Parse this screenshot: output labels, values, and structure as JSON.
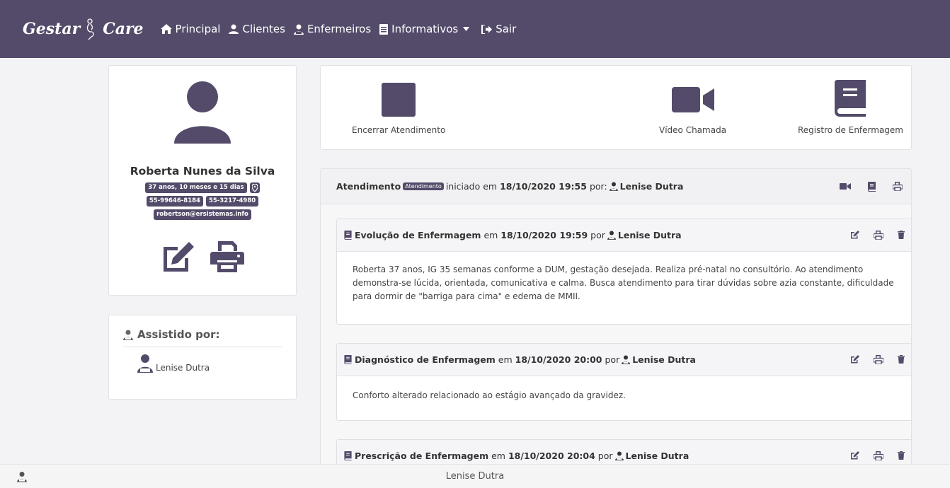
{
  "brand": {
    "name_left": "Gestar",
    "name_right": "Care"
  },
  "nav": {
    "items": [
      {
        "label": "Principal",
        "icon": "home-icon"
      },
      {
        "label": "Clientes",
        "icon": "user-icon"
      },
      {
        "label": "Enfermeiros",
        "icon": "user-nurse-icon"
      },
      {
        "label": "Informativos",
        "icon": "document-icon",
        "dropdown": true
      },
      {
        "label": "Sair",
        "icon": "sign-out-icon"
      }
    ]
  },
  "patient": {
    "name": "Roberta Nunes da Silva",
    "age": "37 anos, 10 meses e 15 dias",
    "phone1": "55-99646-8184",
    "phone2": "55-3217-4980",
    "email": "robertson@ersistemas.info"
  },
  "assisted": {
    "title": "Assistido por:",
    "nurse": "Lenise Dutra"
  },
  "actions": {
    "end": "Encerrar Atendimento",
    "video": "Vídeo Chamada",
    "record": "Registro de Enfermagem"
  },
  "atendimento": {
    "label": "Atendimento",
    "badge": "Atendimento",
    "started": "iniciado em",
    "datetime": "18/10/2020 19:55",
    "by": "por:",
    "user": "Lenise Dutra"
  },
  "entries": [
    {
      "title": "Evolução de Enfermagem",
      "em": "em",
      "datetime": "18/10/2020 19:59",
      "por": "por",
      "user": "Lenise Dutra",
      "body": "Roberta 37 anos, IG 35 semanas conforme a DUM, gestação desejada. Realiza pré-natal no consultório. Ao atendimento demonstra-se lúcida, orientada, comunicativa e calma. Busca atendimento para tirar dúvidas sobre azia constante, dificuldade para dormir de \"barriga para cima\" e edema de MMII."
    },
    {
      "title": "Diagnóstico de Enfermagem",
      "em": "em",
      "datetime": "18/10/2020 20:00",
      "por": "por",
      "user": "Lenise Dutra",
      "body": "Conforto alterado relacionado ao estágio avançado da gravidez."
    },
    {
      "title": "Prescrição de Enfermagem",
      "em": "em",
      "datetime": "18/10/2020 20:04",
      "por": "por",
      "user": "Lenise Dutra",
      "body": ""
    }
  ],
  "footer": {
    "user": "Lenise Dutra"
  },
  "colors": {
    "primary": "#544b6a",
    "background": "#f3f3f5"
  }
}
